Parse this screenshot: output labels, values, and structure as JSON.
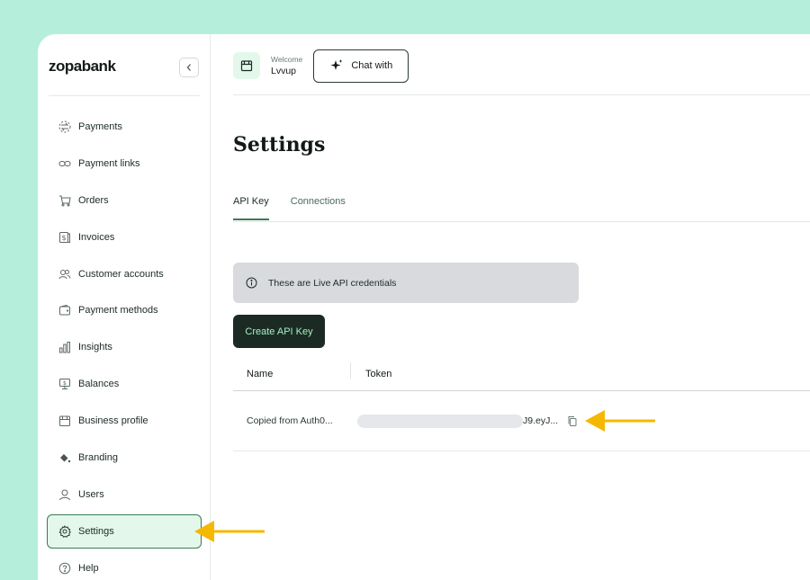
{
  "brand": {
    "name": "zopabank"
  },
  "sidebar": {
    "items": [
      {
        "label": "Payments",
        "icon": "arrows-exchange-icon"
      },
      {
        "label": "Payment links",
        "icon": "link-icon"
      },
      {
        "label": "Orders",
        "icon": "cart-icon"
      },
      {
        "label": "Invoices",
        "icon": "invoice-icon"
      },
      {
        "label": "Customer accounts",
        "icon": "users-icon"
      },
      {
        "label": "Payment methods",
        "icon": "wallet-icon"
      },
      {
        "label": "Insights",
        "icon": "bar-chart-icon"
      },
      {
        "label": "Balances",
        "icon": "balance-icon"
      },
      {
        "label": "Business profile",
        "icon": "store-icon"
      },
      {
        "label": "Branding",
        "icon": "paint-bucket-icon"
      },
      {
        "label": "Users",
        "icon": "user-icon"
      },
      {
        "label": "Settings",
        "icon": "gear-icon",
        "active": true
      },
      {
        "label": "Help",
        "icon": "help-icon"
      }
    ]
  },
  "header": {
    "welcome_label": "Welcome",
    "user_name": "Lvvup",
    "chat_label": "Chat with"
  },
  "main": {
    "title": "Settings",
    "tabs": [
      {
        "label": "API Key",
        "active": true
      },
      {
        "label": "Connections",
        "active": false
      }
    ],
    "notice": "These are Live API credentials",
    "create_label": "Create API Key",
    "table": {
      "columns": [
        "Name",
        "Token"
      ],
      "rows": [
        {
          "name": "Copied from Auth0...",
          "token_tail": "J9.eyJ..."
        }
      ]
    }
  },
  "colors": {
    "background": "#b5efdb",
    "accent": "#3a7a58",
    "dark_button": "#1b2b24",
    "arrow": "#f5b800"
  }
}
